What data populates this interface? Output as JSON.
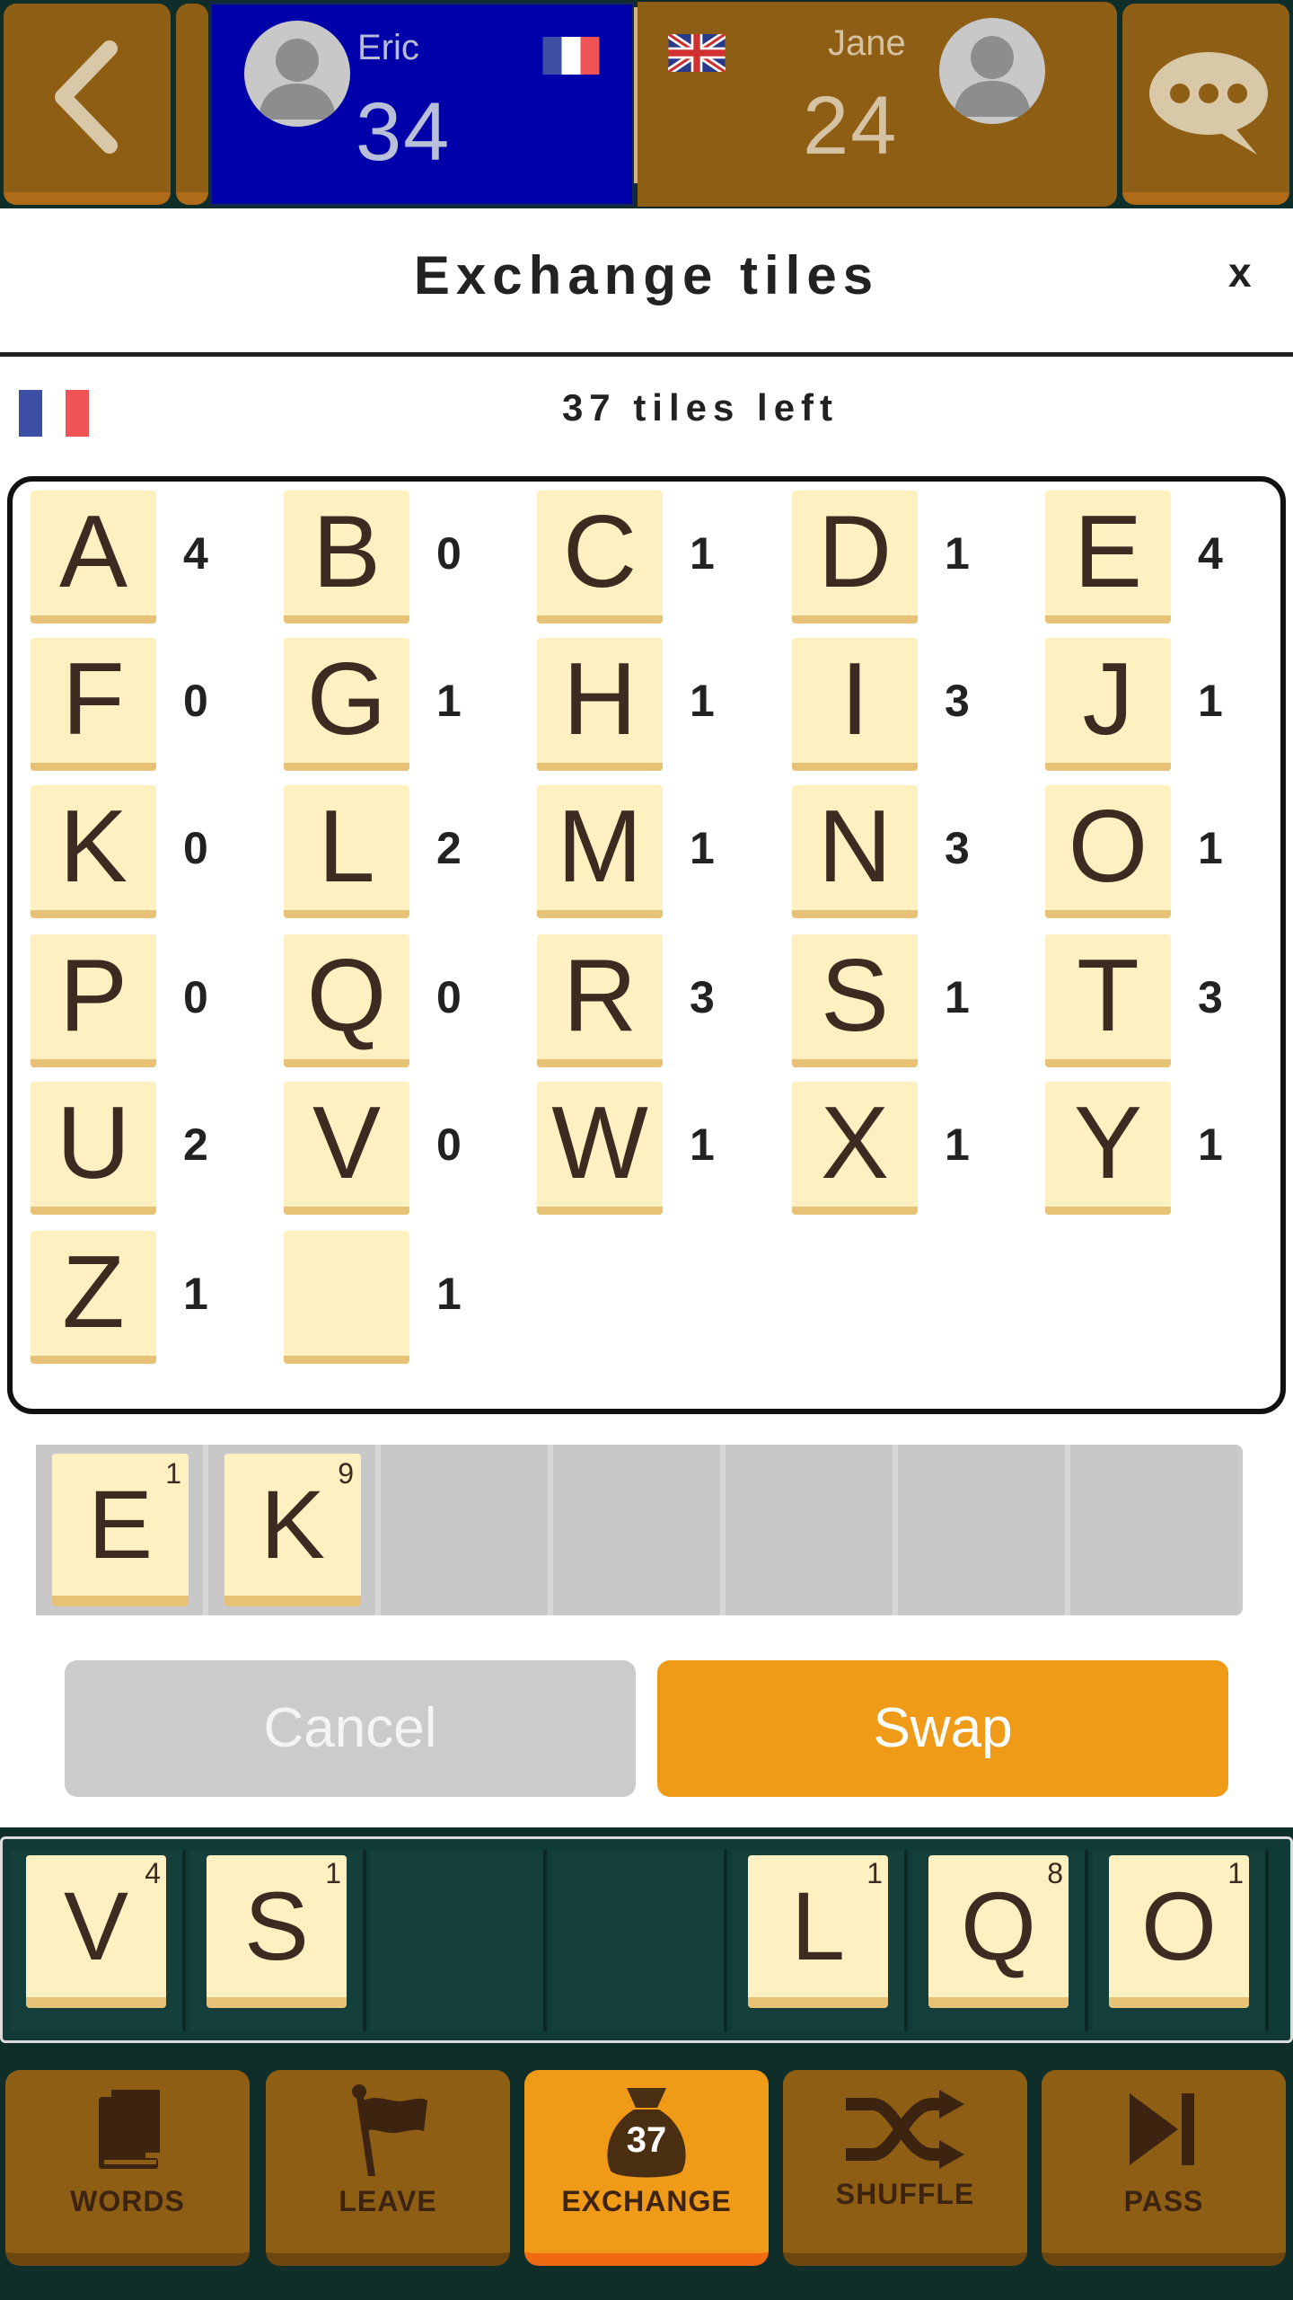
{
  "header": {
    "player_left": {
      "name": "Eric",
      "score": "34",
      "flag": "france-flag"
    },
    "player_right": {
      "name": "Jane",
      "score": "24",
      "flag": "uk-flag"
    },
    "back_icon": "chevron-left-icon",
    "chat_icon": "chat-bubble-icon"
  },
  "dialog": {
    "title": "Exchange tiles",
    "close_label": "x",
    "bag_language_flag": "france-flag",
    "tiles_left": "37 tiles left"
  },
  "letter_distribution": [
    {
      "letter": "A",
      "count": "4"
    },
    {
      "letter": "B",
      "count": "0"
    },
    {
      "letter": "C",
      "count": "1"
    },
    {
      "letter": "D",
      "count": "1"
    },
    {
      "letter": "E",
      "count": "4"
    },
    {
      "letter": "F",
      "count": "0"
    },
    {
      "letter": "G",
      "count": "1"
    },
    {
      "letter": "H",
      "count": "1"
    },
    {
      "letter": "I",
      "count": "3"
    },
    {
      "letter": "J",
      "count": "1"
    },
    {
      "letter": "K",
      "count": "0"
    },
    {
      "letter": "L",
      "count": "2"
    },
    {
      "letter": "M",
      "count": "1"
    },
    {
      "letter": "N",
      "count": "3"
    },
    {
      "letter": "O",
      "count": "1"
    },
    {
      "letter": "P",
      "count": "0"
    },
    {
      "letter": "Q",
      "count": "0"
    },
    {
      "letter": "R",
      "count": "3"
    },
    {
      "letter": "S",
      "count": "1"
    },
    {
      "letter": "T",
      "count": "3"
    },
    {
      "letter": "U",
      "count": "2"
    },
    {
      "letter": "V",
      "count": "0"
    },
    {
      "letter": "W",
      "count": "1"
    },
    {
      "letter": "X",
      "count": "1"
    },
    {
      "letter": "Y",
      "count": "1"
    },
    {
      "letter": "Z",
      "count": "1"
    },
    {
      "letter": "",
      "count": "1"
    }
  ],
  "swap_rack": [
    {
      "letter": "E",
      "value": "1"
    },
    {
      "letter": "K",
      "value": "9"
    }
  ],
  "buttons": {
    "cancel": "Cancel",
    "swap": "Swap"
  },
  "player_rack": [
    {
      "letter": "V",
      "value": "4"
    },
    {
      "letter": "S",
      "value": "1"
    },
    null,
    null,
    {
      "letter": "L",
      "value": "1"
    },
    {
      "letter": "Q",
      "value": "8"
    },
    {
      "letter": "O",
      "value": "1"
    }
  ],
  "toolbar": {
    "words": "WORDS",
    "leave": "LEAVE",
    "exchange": "EXCHANGE",
    "exchange_count": "37",
    "shuffle": "SHUFFLE",
    "pass": "PASS"
  },
  "colors": {
    "tile": "#fff0c1",
    "accent": "#ef9b17",
    "wood": "#8e5e14",
    "board": "#0f2e2a",
    "player_highlight": "#0000aa"
  }
}
